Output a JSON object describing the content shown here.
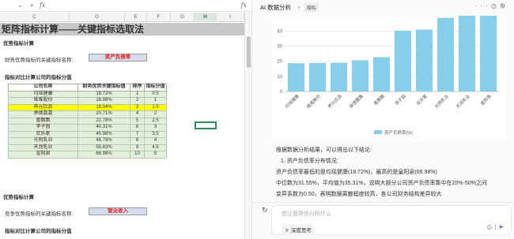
{
  "formula_bar": {
    "zoom_icon": "zoom-icon",
    "fx": "fx",
    "fx_right": "fx"
  },
  "columns": [
    "C",
    "D",
    "E",
    "F",
    "G",
    "H",
    "I"
  ],
  "selected_column": "H",
  "sheet": {
    "title": "矩阵指标计算——关键指标选取法",
    "section1": {
      "heading": "优势指标计算",
      "key_label": "财务优势指标的关键指标名称:",
      "key_value": "资产负债率",
      "sub_heading": "指标对比计算公司的指标分值",
      "table": {
        "headers": [
          "公司名称",
          "财务优势关键指标值",
          "排序",
          "指标分值"
        ],
        "rows": [
          [
            "均瑶健康",
            "18.72%",
            "1",
            "0.5"
          ],
          [
            "维维股份",
            "18.98%",
            "2",
            "1"
          ],
          [
            "养元饮品",
            "19.04%",
            "3",
            "1.5"
          ],
          [
            "承德露露",
            "20.71%",
            "4",
            "2"
          ],
          [
            "香飘飘",
            "22.78%",
            "5",
            "2.5"
          ],
          [
            "李子园",
            "40.31%",
            "6",
            "3"
          ],
          [
            "欢乐家",
            "40.98%",
            "7",
            "3.5"
          ],
          [
            "光明乳业",
            "48.79%",
            "8",
            "4"
          ],
          [
            "天润乳业",
            "55.83%",
            "9",
            "4.5"
          ],
          [
            "皇阳泉",
            "66.98%",
            "10",
            "5"
          ]
        ],
        "highlight_row": 2
      }
    },
    "section2": {
      "heading": "优势指标计算",
      "key_label": "竞争优势指标的关键指标名称:",
      "key_value": "营业收入",
      "sub_heading": "指标对比计算公司的指标分值"
    }
  },
  "panel": {
    "title": "AI 数据分析",
    "badge": "隐私",
    "icons": [
      "more-icon",
      "history-icon",
      "settings-icon"
    ],
    "analysis_lines": [
      "根据数据分析结果，可以得出以下结论:",
      "1. 资产负债率分布情况:",
      "资产负债率最低的是均瑶健康(18.72%)，最高的是皇阳泉(66.98%)",
      "中位数为31.55%，平均值为35.31%，说明大部分公司资产负债率集中在20%-50%之间",
      "变异系数为0.50，表明数据离散程度较高，各公司财务结构差异较大"
    ],
    "input_placeholder": "想让我帮你分析什么",
    "deep_think": "深度思考",
    "accent_color": "#6b5bd6"
  },
  "chart_data": {
    "type": "bar",
    "categories": [
      "均瑶健康",
      "维维股份",
      "养元饮品",
      "承德露露",
      "香飘飘",
      "李子园",
      "欢乐家",
      "光明乳业",
      "天润乳业",
      "皇阳泉"
    ],
    "series": [
      {
        "name": "资产负债率(%)",
        "values": [
          18.72,
          18.98,
          19.04,
          20.71,
          22.78,
          40.31,
          40.98,
          48.79,
          55.83,
          66.98
        ],
        "color": "#87ceeb"
      }
    ],
    "yticks": [
      0,
      10,
      20,
      30,
      40
    ],
    "ylim": [
      0,
      46
    ],
    "legend_position": "bottom",
    "grid": true
  }
}
